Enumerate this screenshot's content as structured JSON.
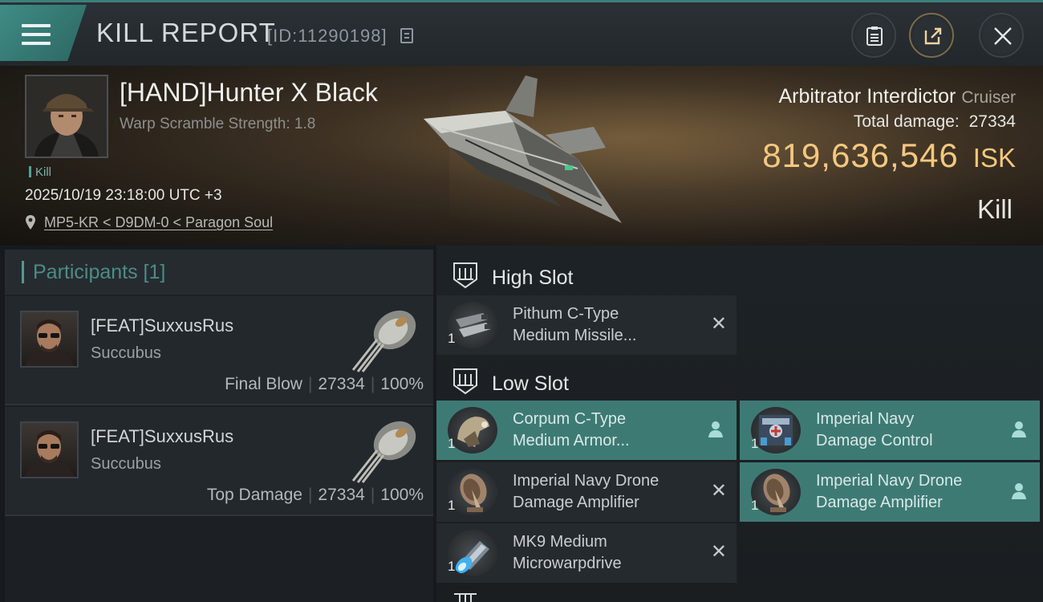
{
  "header": {
    "title": "KILL REPORT",
    "report_id": "[ID:11290198]",
    "icons": [
      "menu-icon",
      "copy-icon",
      "clipboard-icon",
      "share-icon",
      "close-icon"
    ]
  },
  "victim": {
    "name": "[HAND]Hunter X Black",
    "warp_scramble": "Warp Scramble Strength: 1.8",
    "tag": "Kill",
    "datetime": "2025/10/19 23:18:00 UTC +3",
    "location": "MP5-KR < D9DM-0 < Paragon Soul",
    "ship_name": "Arbitrator Interdictor",
    "ship_class": "Cruiser",
    "total_damage_label": "Total damage:",
    "total_damage": "27334",
    "isk_value": "819,636,546",
    "isk_unit": "ISK",
    "result": "Kill"
  },
  "participants": {
    "title": "Participants [1]",
    "rows": [
      {
        "name": "[FEAT]SuxxusRus",
        "ship": "Succubus",
        "role": "Final Blow",
        "damage": "27334",
        "percent": "100%"
      },
      {
        "name": "[FEAT]SuxxusRus",
        "ship": "Succubus",
        "role": "Top Damage",
        "damage": "27334",
        "percent": "100%"
      }
    ]
  },
  "fitting": {
    "high_slot": {
      "title": "High Slot",
      "modules": [
        {
          "line1": "Pithum C-Type",
          "line2": "Medium Missile...",
          "qty": "1",
          "status": "destroyed"
        }
      ]
    },
    "low_slot": {
      "title": "Low Slot",
      "modules": [
        {
          "line1": "Corpum C-Type",
          "line2": "Medium Armor...",
          "qty": "1",
          "status": "dropped"
        },
        {
          "line1": "Imperial Navy",
          "line2": "Damage Control",
          "qty": "1",
          "status": "dropped"
        },
        {
          "line1": "Imperial Navy Drone",
          "line2": "Damage Amplifier",
          "qty": "1",
          "status": "destroyed"
        },
        {
          "line1": "Imperial Navy Drone",
          "line2": "Damage Amplifier",
          "qty": "1",
          "status": "dropped"
        },
        {
          "line1": "MK9 Medium",
          "line2": "Microwarpdrive",
          "qty": "1",
          "status": "destroyed"
        }
      ]
    },
    "destroyed_symbol": "✕",
    "accent_color": "#3e7a74"
  },
  "colors": {
    "isk": "#f3c880",
    "accent": "#4c9c95"
  }
}
